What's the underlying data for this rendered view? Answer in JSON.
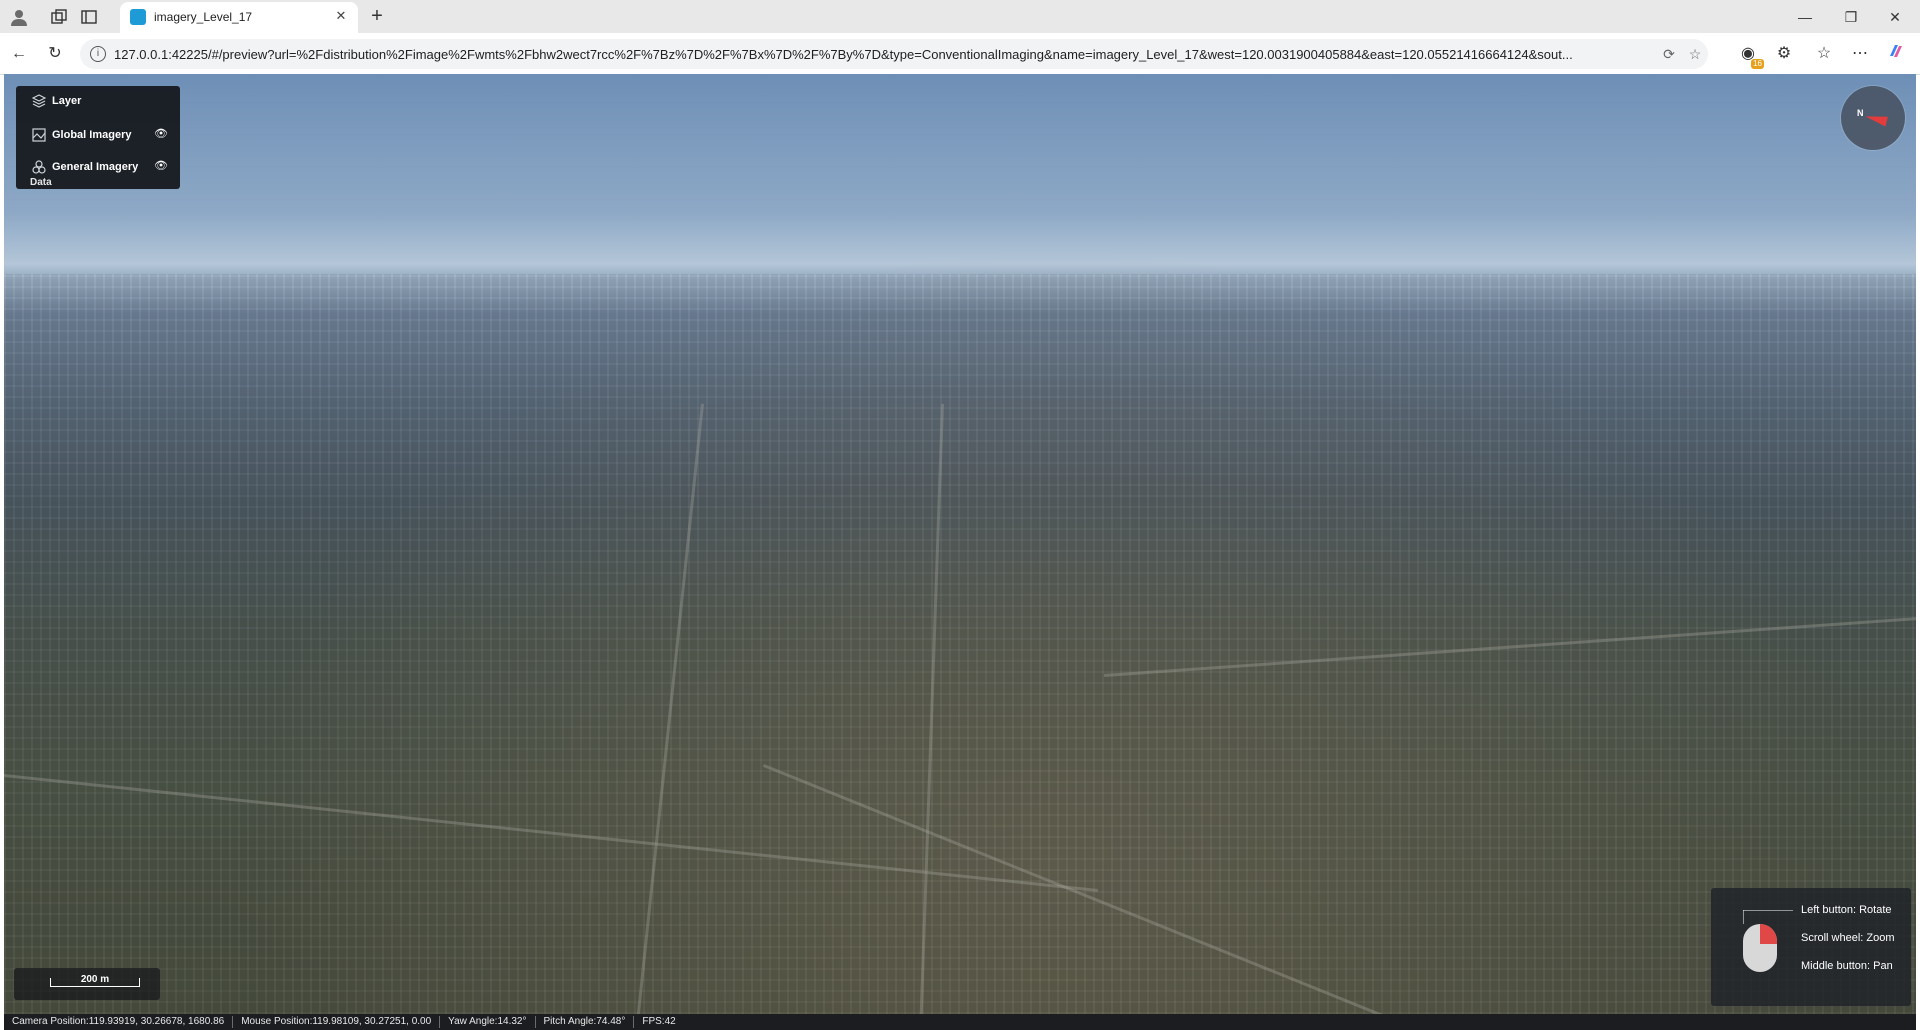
{
  "browser": {
    "tab": {
      "title": "imagery_Level_17",
      "close_icon": "close-icon"
    },
    "new_tab_icon": "plus-icon",
    "url": "127.0.0.1:42225/#/preview?url=%2Fdistribution%2Fimage%2Fwmts%2Fbhw2wect7rcc%2F%7Bz%7D%2F%7Bx%7D%2F%7By%7D&type=ConventionalImaging&name=imagery_Level_17&west=120.0031900405884&east=120.05521416664124&sout...",
    "extension_badge": "16",
    "window_controls": [
      "minimize-icon",
      "restore-icon",
      "close-icon"
    ]
  },
  "layer_panel": {
    "header": "Layer",
    "items": [
      {
        "label": "Global Imagery",
        "icon": "imagery-icon",
        "visible": true
      },
      {
        "label": "General Imagery",
        "icon": "tiles-icon",
        "visible": true
      }
    ],
    "overflow_text": "Data"
  },
  "compass": {
    "label": "N",
    "needle_color": "#e33c3c"
  },
  "scale": {
    "label": "200 m"
  },
  "mouse_help": {
    "left": "Left button: Rotate",
    "scroll": "Scroll wheel: Zoom",
    "middle": "Middle button: Pan"
  },
  "status": {
    "camera": "Camera Position:119.93919, 30.26678, 1680.86",
    "mouse": "Mouse Position:119.98109, 30.27251, 0.00",
    "yaw": "Yaw Angle:14.32°",
    "pitch": "Pitch Angle:74.48°",
    "fps": "FPS:42"
  }
}
